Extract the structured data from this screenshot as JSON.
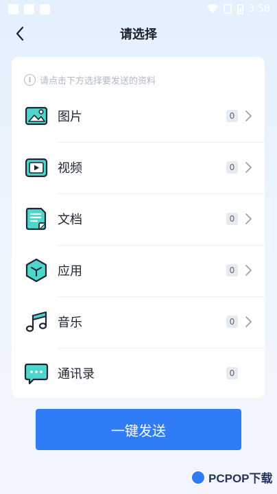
{
  "status_bar": {
    "time": "3:58",
    "left_icons": [
      "image-notification-icon",
      "gallery-notification-icon",
      "text-notification-icon"
    ],
    "right_icons": [
      "wifi-icon",
      "no-sim-icon",
      "battery-icon"
    ]
  },
  "header": {
    "title": "请选择",
    "back_icon": "back-arrow-icon"
  },
  "hint": {
    "icon": "info-icon",
    "text": "请点击下方选择要发送的资料"
  },
  "items": [
    {
      "label": "图片",
      "count": "0",
      "icon": "image-icon",
      "has_chevron": true
    },
    {
      "label": "视频",
      "count": "0",
      "icon": "video-icon",
      "has_chevron": true
    },
    {
      "label": "文档",
      "count": "0",
      "icon": "document-icon",
      "has_chevron": true
    },
    {
      "label": "应用",
      "count": "0",
      "icon": "app-icon",
      "has_chevron": true
    },
    {
      "label": "音乐",
      "count": "0",
      "icon": "music-icon",
      "has_chevron": true
    },
    {
      "label": "通讯录",
      "count": "0",
      "icon": "contacts-icon",
      "has_chevron": false
    }
  ],
  "send_button": {
    "label": "一键发送"
  },
  "watermark": {
    "text": "PCPOP下载"
  },
  "colors": {
    "accent": "#2f7cf6",
    "icon_fill": "#4fd6cc",
    "icon_stroke": "#1f2533",
    "background": "#eaf3fd"
  }
}
